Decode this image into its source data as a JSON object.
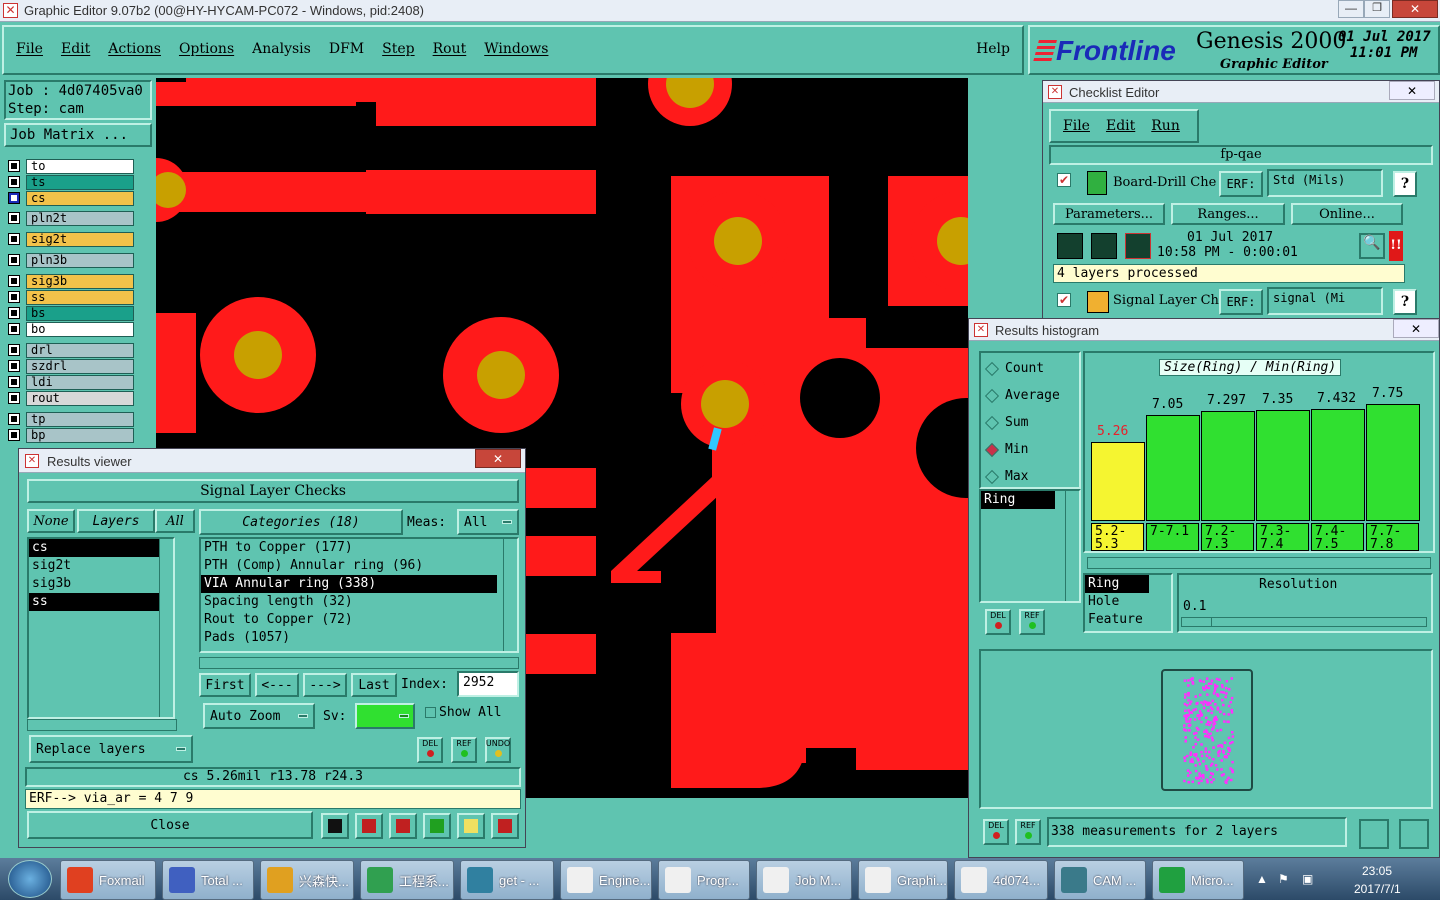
{
  "window": {
    "title": "Graphic Editor 9.07b2 (00@HY-HYCAM-PC072 - Windows, pid:2408)"
  },
  "menu": {
    "items": [
      "File",
      "Edit",
      "Actions",
      "Options",
      "Analysis",
      "DFM",
      "Step",
      "Rout",
      "Windows"
    ],
    "help": "Help"
  },
  "brand": {
    "logo": "Frontline",
    "product": "Genesis 2000",
    "subtitle": "Graphic Editor",
    "date": "01 Jul 2017",
    "time": "11:01 PM"
  },
  "job": {
    "job_label": "Job : 4d07405va0",
    "step_label": "Step: cam",
    "matrix_button": "Job Matrix ..."
  },
  "layers": [
    {
      "name": "to",
      "color": "#ffffff",
      "checked": false
    },
    {
      "name": "ts",
      "color": "#1aa08a",
      "checked": false
    },
    {
      "name": "cs",
      "color": "#f2c24a",
      "checked": true
    },
    {
      "name": "pln2t",
      "color": "#a8c4c8",
      "checked": false
    },
    {
      "name": "sig2t",
      "color": "#f2c24a",
      "checked": false
    },
    {
      "name": "pln3b",
      "color": "#a8c4c8",
      "checked": false
    },
    {
      "name": "sig3b",
      "color": "#f2c24a",
      "checked": false
    },
    {
      "name": "ss",
      "color": "#f2c24a",
      "checked": false
    },
    {
      "name": "bs",
      "color": "#1aa08a",
      "checked": false
    },
    {
      "name": "bo",
      "color": "#ffffff",
      "checked": false
    },
    {
      "name": "drl",
      "color": "#a8c4c8",
      "checked": false
    },
    {
      "name": "szdrl",
      "color": "#a8c4c8",
      "checked": false
    },
    {
      "name": "ldi",
      "color": "#a8c4c8",
      "checked": false
    },
    {
      "name": "rout",
      "color": "#d8d8d8",
      "checked": false
    },
    {
      "name": "tp",
      "color": "#a8c4c8",
      "checked": false
    },
    {
      "name": "bp",
      "color": "#a8c4c8",
      "checked": false
    }
  ],
  "checklist": {
    "title": "Checklist Editor",
    "menu": [
      "File",
      "Edit",
      "Run"
    ],
    "name": "fp-qae",
    "check1": {
      "name": "Board-Drill Che",
      "erf": "ERF:",
      "erf_value": "Std (Mils)",
      "help": "?"
    },
    "buttons": [
      "Parameters...",
      "Ranges...",
      "Online..."
    ],
    "run_date": "01 Jul 2017",
    "run_time": "10:58 PM - 0:00:01",
    "status": "4 layers processed",
    "check2": {
      "name": "Signal Layer Ch",
      "erf": "ERF:",
      "erf_value": "signal (Mi",
      "help": "?"
    }
  },
  "histogram": {
    "title": "Results histogram",
    "modes": [
      "Count",
      "Average",
      "Sum",
      "Min",
      "Max"
    ],
    "selected_mode": "Min",
    "list_selected": "Ring",
    "chart_title": "Size(Ring) / Min(Ring)",
    "bars": [
      {
        "value": "5.26",
        "range": "5.2-5.3",
        "height": 0.67,
        "color": "#f5f530",
        "label_color": "#e8202a"
      },
      {
        "value": "7.05",
        "range": "7-7.1",
        "height": 0.9,
        "color": "#30e030",
        "label_color": "#000"
      },
      {
        "value": "7.297",
        "range": "7.2-7.3",
        "height": 0.93,
        "color": "#30e030",
        "label_color": "#000"
      },
      {
        "value": "7.35",
        "range": "7.3-7.4",
        "height": 0.94,
        "color": "#30e030",
        "label_color": "#000"
      },
      {
        "value": "7.432",
        "range": "7.4-7.5",
        "height": 0.95,
        "color": "#30e030",
        "label_color": "#000"
      },
      {
        "value": "7.75",
        "range": "7.7-7.8",
        "height": 0.99,
        "color": "#30e030",
        "label_color": "#000"
      }
    ],
    "measure_items": [
      "Ring",
      "Hole",
      "Feature"
    ],
    "resolution_label": "Resolution",
    "resolution_value": "0.1",
    "summary": "338 measurements for 2 layers",
    "del": "DEL",
    "ref": "REF"
  },
  "results_viewer": {
    "title": "Results viewer",
    "header": "Signal Layer Checks",
    "none": "None",
    "layers": "Layers",
    "all": "All",
    "categories": "Categories (18)",
    "meas_label": "Meas:",
    "meas_value": "All",
    "layer_list": [
      "cs",
      "sig2t",
      "sig3b",
      "ss"
    ],
    "layer_selected": [
      "cs",
      "ss"
    ],
    "category_list": [
      "PTH to Copper (177)",
      "PTH (Comp) Annular ring (96)",
      "VIA Annular ring (338)",
      "Spacing length (32)",
      "Rout to Copper (72)",
      "Pads (1057)"
    ],
    "category_selected": "VIA Annular ring (338)",
    "nav": [
      "First",
      "<---",
      "--->",
      "Last"
    ],
    "index_label": "Index:",
    "index_value": "2952",
    "auto_zoom": "Auto Zoom",
    "sv_label": "Sv:",
    "show_all": "Show All",
    "replace_layers": "Replace layers",
    "del": "DEL",
    "ref": "REF",
    "undo": "UNDO",
    "status_line": "cs 5.26mil r13.78 r24.3",
    "erf_line": "ERF--> via_ar = 4 7 9",
    "close": "Close"
  },
  "taskbar": {
    "items": [
      "Foxmail",
      "Total ...",
      "兴森快...",
      "工程系...",
      "get - ...",
      "Engine...",
      "Progr...",
      "Job M...",
      "Graphi...",
      "4d074...",
      "CAM ...",
      "Micro..."
    ],
    "time": "23:05",
    "date": "2017/7/1"
  },
  "colors": {
    "panel": "#5fc4b0",
    "copper": "#ff1a1a",
    "drill": "#c8a000",
    "canvas": "#000000"
  }
}
